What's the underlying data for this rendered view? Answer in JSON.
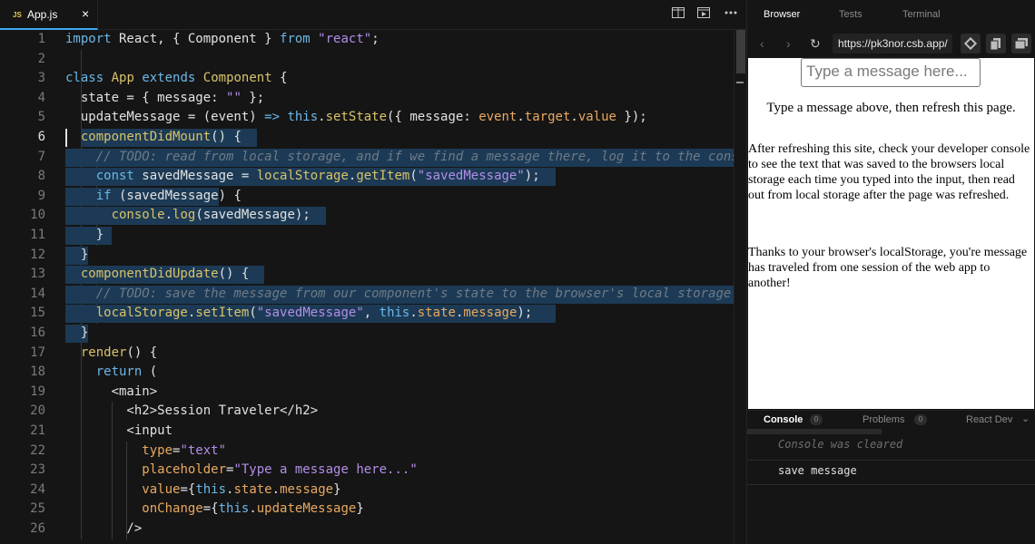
{
  "editor": {
    "tab": {
      "lang": "JS",
      "name": "App.js",
      "close": "×"
    },
    "actions": [
      "split-view-icon",
      "preview-icon",
      "more-icon"
    ],
    "lines": [
      {
        "n": "1",
        "tokens": [
          [
            "k",
            "import"
          ],
          [
            "t",
            " React, { Component } "
          ],
          [
            "k",
            "from"
          ],
          [
            "t",
            " "
          ],
          [
            "s",
            "\"react\""
          ],
          [
            "t",
            ";"
          ]
        ]
      },
      {
        "n": "2",
        "tokens": []
      },
      {
        "n": "3",
        "tokens": [
          [
            "k",
            "class"
          ],
          [
            "t",
            " "
          ],
          [
            "f",
            "App"
          ],
          [
            "t",
            " "
          ],
          [
            "k",
            "extends"
          ],
          [
            "t",
            " "
          ],
          [
            "f",
            "Component"
          ],
          [
            "t",
            " {"
          ]
        ]
      },
      {
        "n": "4",
        "tokens": [
          [
            "t",
            "  state = { message: "
          ],
          [
            "s",
            "\"\""
          ],
          [
            "t",
            " };"
          ]
        ]
      },
      {
        "n": "5",
        "tokens": [
          [
            "t",
            "  updateMessage = (event) "
          ],
          [
            "k",
            "=>"
          ],
          [
            "t",
            " "
          ],
          [
            "k",
            "this"
          ],
          [
            "t",
            "."
          ],
          [
            "f",
            "setState"
          ],
          [
            "t",
            "({ message: "
          ],
          [
            "p",
            "event"
          ],
          [
            "t",
            "."
          ],
          [
            "p",
            "target"
          ],
          [
            "t",
            "."
          ],
          [
            "p",
            "value"
          ],
          [
            "t",
            " });"
          ]
        ]
      },
      {
        "n": "6",
        "tokens": [
          [
            "t",
            "  "
          ],
          [
            "f",
            "componentDidMount"
          ],
          [
            "t",
            "() {"
          ]
        ]
      },
      {
        "n": "7",
        "tokens": [
          [
            "c",
            "    // TODO: read from local storage, and if we find a message there, log it to the console"
          ]
        ]
      },
      {
        "n": "8",
        "tokens": [
          [
            "t",
            "    "
          ],
          [
            "k",
            "const"
          ],
          [
            "t",
            " savedMessage = "
          ],
          [
            "f",
            "localStorage"
          ],
          [
            "t",
            "."
          ],
          [
            "f",
            "getItem"
          ],
          [
            "t",
            "("
          ],
          [
            "s",
            "\"savedMessage\""
          ],
          [
            "t",
            ");"
          ]
        ]
      },
      {
        "n": "9",
        "tokens": [
          [
            "t",
            "    "
          ],
          [
            "k",
            "if"
          ],
          [
            "t",
            " (savedMessage) {"
          ]
        ]
      },
      {
        "n": "10",
        "tokens": [
          [
            "t",
            "      "
          ],
          [
            "f",
            "console"
          ],
          [
            "t",
            "."
          ],
          [
            "f",
            "log"
          ],
          [
            "t",
            "(savedMessage);"
          ]
        ]
      },
      {
        "n": "11",
        "tokens": [
          [
            "t",
            "    }"
          ]
        ]
      },
      {
        "n": "12",
        "tokens": [
          [
            "t",
            "  }"
          ]
        ]
      },
      {
        "n": "13",
        "tokens": [
          [
            "t",
            "  "
          ],
          [
            "f",
            "componentDidUpdate"
          ],
          [
            "t",
            "() {"
          ]
        ]
      },
      {
        "n": "14",
        "tokens": [
          [
            "c",
            "    // TODO: save the message from our component's state to the browser's local storage"
          ]
        ]
      },
      {
        "n": "15",
        "tokens": [
          [
            "t",
            "    "
          ],
          [
            "f",
            "localStorage"
          ],
          [
            "t",
            "."
          ],
          [
            "f",
            "setItem"
          ],
          [
            "t",
            "("
          ],
          [
            "s",
            "\"savedMessage\""
          ],
          [
            "t",
            ", "
          ],
          [
            "k",
            "this"
          ],
          [
            "t",
            "."
          ],
          [
            "p",
            "state"
          ],
          [
            "t",
            "."
          ],
          [
            "p",
            "message"
          ],
          [
            "t",
            ");"
          ]
        ]
      },
      {
        "n": "16",
        "tokens": [
          [
            "t",
            "  }"
          ]
        ]
      },
      {
        "n": "17",
        "tokens": [
          [
            "t",
            "  "
          ],
          [
            "f",
            "render"
          ],
          [
            "t",
            "() {"
          ]
        ]
      },
      {
        "n": "18",
        "tokens": [
          [
            "t",
            "    "
          ],
          [
            "k",
            "return"
          ],
          [
            "t",
            " ("
          ]
        ]
      },
      {
        "n": "19",
        "tokens": [
          [
            "t",
            "      <main>"
          ]
        ]
      },
      {
        "n": "20",
        "tokens": [
          [
            "t",
            "        <h2>Session Traveler</h2>"
          ]
        ]
      },
      {
        "n": "21",
        "tokens": [
          [
            "t",
            "        <input"
          ]
        ]
      },
      {
        "n": "22",
        "tokens": [
          [
            "t",
            "          "
          ],
          [
            "p",
            "type"
          ],
          [
            "t",
            "="
          ],
          [
            "s",
            "\"text\""
          ]
        ]
      },
      {
        "n": "23",
        "tokens": [
          [
            "t",
            "          "
          ],
          [
            "p",
            "placeholder"
          ],
          [
            "t",
            "="
          ],
          [
            "s",
            "\"Type a message here...\""
          ]
        ]
      },
      {
        "n": "24",
        "tokens": [
          [
            "t",
            "          "
          ],
          [
            "p",
            "value"
          ],
          [
            "t",
            "={"
          ],
          [
            "k",
            "this"
          ],
          [
            "t",
            "."
          ],
          [
            "p",
            "state"
          ],
          [
            "t",
            "."
          ],
          [
            "p",
            "message"
          ],
          [
            "t",
            "}"
          ]
        ]
      },
      {
        "n": "25",
        "tokens": [
          [
            "t",
            "          "
          ],
          [
            "p",
            "onChange"
          ],
          [
            "t",
            "={"
          ],
          [
            "k",
            "this"
          ],
          [
            "t",
            "."
          ],
          [
            "p",
            "updateMessage"
          ],
          [
            "t",
            "}"
          ]
        ]
      },
      {
        "n": "26",
        "tokens": [
          [
            "t",
            "        />"
          ]
        ]
      }
    ]
  },
  "panel": {
    "tabs": [
      "Browser",
      "Tests",
      "Terminal"
    ],
    "nav": {
      "back": "‹",
      "forward": "›",
      "refresh": "↻",
      "url": "https://pk3nor.csb.app/"
    },
    "preview": {
      "input_placeholder": "Type a message here...",
      "instruction": "Type a message above, then refresh this page.",
      "paragraph1": "After refreshing this site, check your developer console to see the text that was saved to the browsers local storage each time you typed into the input, then read out from local storage after the page was refreshed.",
      "paragraph2": "Thanks to your browser's localStorage, you're message has traveled from one session of the web app to another!"
    },
    "console": {
      "tabs": [
        {
          "label": "Console",
          "count": "0"
        },
        {
          "label": "Problems",
          "count": "0"
        },
        {
          "label": "React Dev",
          "count": ""
        }
      ],
      "collapse": "⌄",
      "cleared": "Console was cleared",
      "entries": [
        "save message"
      ]
    }
  },
  "colors": {
    "accent": "#40a9f3",
    "selection": "#1c3a55",
    "background": "#151515"
  }
}
